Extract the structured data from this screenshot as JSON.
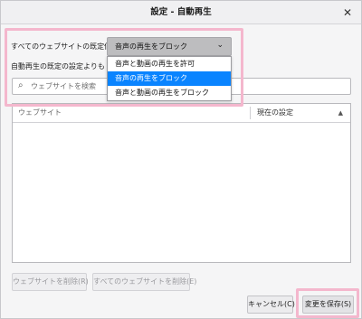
{
  "window": {
    "title": "設定 - 自動再生",
    "close_glyph": "✕"
  },
  "default_setting": {
    "label": "すべてのウェブサイトの既定値:",
    "selected": "音声の再生をブロック",
    "options": [
      "音声と動画の再生を許可",
      "音声の再生をブロック",
      "音声と動画の再生をブロック"
    ],
    "highlighted_option_index": 1
  },
  "info_text": "自動再生の既定の設定よりも",
  "search": {
    "placeholder": "ウェブサイトを検索",
    "value": ""
  },
  "table": {
    "columns": [
      "ウェブサイト",
      "現在の設定"
    ],
    "rows": []
  },
  "buttons": {
    "remove": "ウェブサイトを削除(R)",
    "remove_all": "すべてのウェブサイトを削除(E)",
    "cancel": "キャンセル(C)",
    "save": "変更を保存(S)"
  },
  "colors": {
    "highlight_box": "#f4b7cd",
    "selected_option": "#0a84ff"
  },
  "icons": {
    "close": "close-icon",
    "chevron": "chevron-down-icon",
    "search": "search-icon",
    "sort": "sort-ascending-icon"
  }
}
